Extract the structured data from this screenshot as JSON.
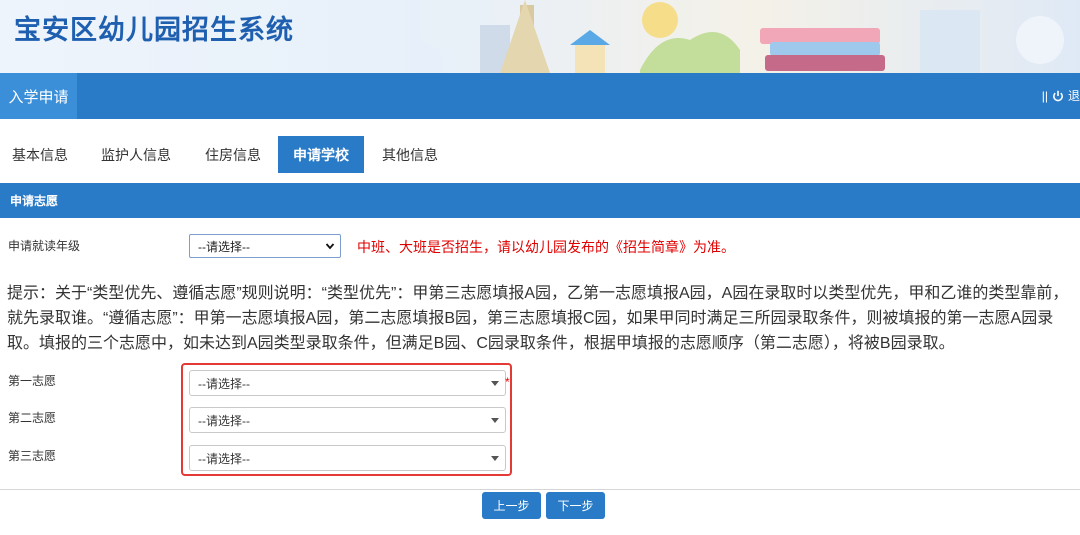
{
  "header": {
    "title": "宝安区幼儿园招生系统"
  },
  "navbar": {
    "active_item": "入学申请",
    "separator": "||",
    "logout_partial": "退"
  },
  "tabs": [
    {
      "label": "基本信息",
      "active": false
    },
    {
      "label": "监护人信息",
      "active": false
    },
    {
      "label": "住房信息",
      "active": false
    },
    {
      "label": "申请学校",
      "active": true
    },
    {
      "label": "其他信息",
      "active": false
    }
  ],
  "section": {
    "title": "申请志愿"
  },
  "grade": {
    "label": "申请就读年级",
    "selected": "--请选择--",
    "warning": "中班、大班是否招生，请以幼儿园发布的《招生简章》为准。"
  },
  "hint": "提示：关于“类型优先、遵循志愿”规则说明：“类型优先”：甲第三志愿填报A园，乙第一志愿填报A园，A园在录取时以类型优先，甲和乙谁的类型靠前，就先录取谁。“遵循志愿”：甲第一志愿填报A园，第二志愿填报B园，第三志愿填报C园，如果甲同时满足三所园录取条件，则被填报的第一志愿A园录取。填报的三个志愿中，如未达到A园类型录取条件，但满足B园、C园录取条件，根据甲填报的志愿顺序（第二志愿），将被B园录取。",
  "choices": [
    {
      "label": "第一志愿",
      "selected": "--请选择--",
      "required": "*"
    },
    {
      "label": "第二志愿",
      "selected": "--请选择--"
    },
    {
      "label": "第三志愿",
      "selected": "--请选择--"
    }
  ],
  "buttons": {
    "prev": "上一步",
    "next": "下一步"
  },
  "colors": {
    "primary": "#2a7bc7",
    "title": "#1f5fb0",
    "warning": "#e00000",
    "highlight": "#e53935"
  },
  "icons": {
    "power": "power-icon",
    "chevron": "chevron-down-icon"
  }
}
